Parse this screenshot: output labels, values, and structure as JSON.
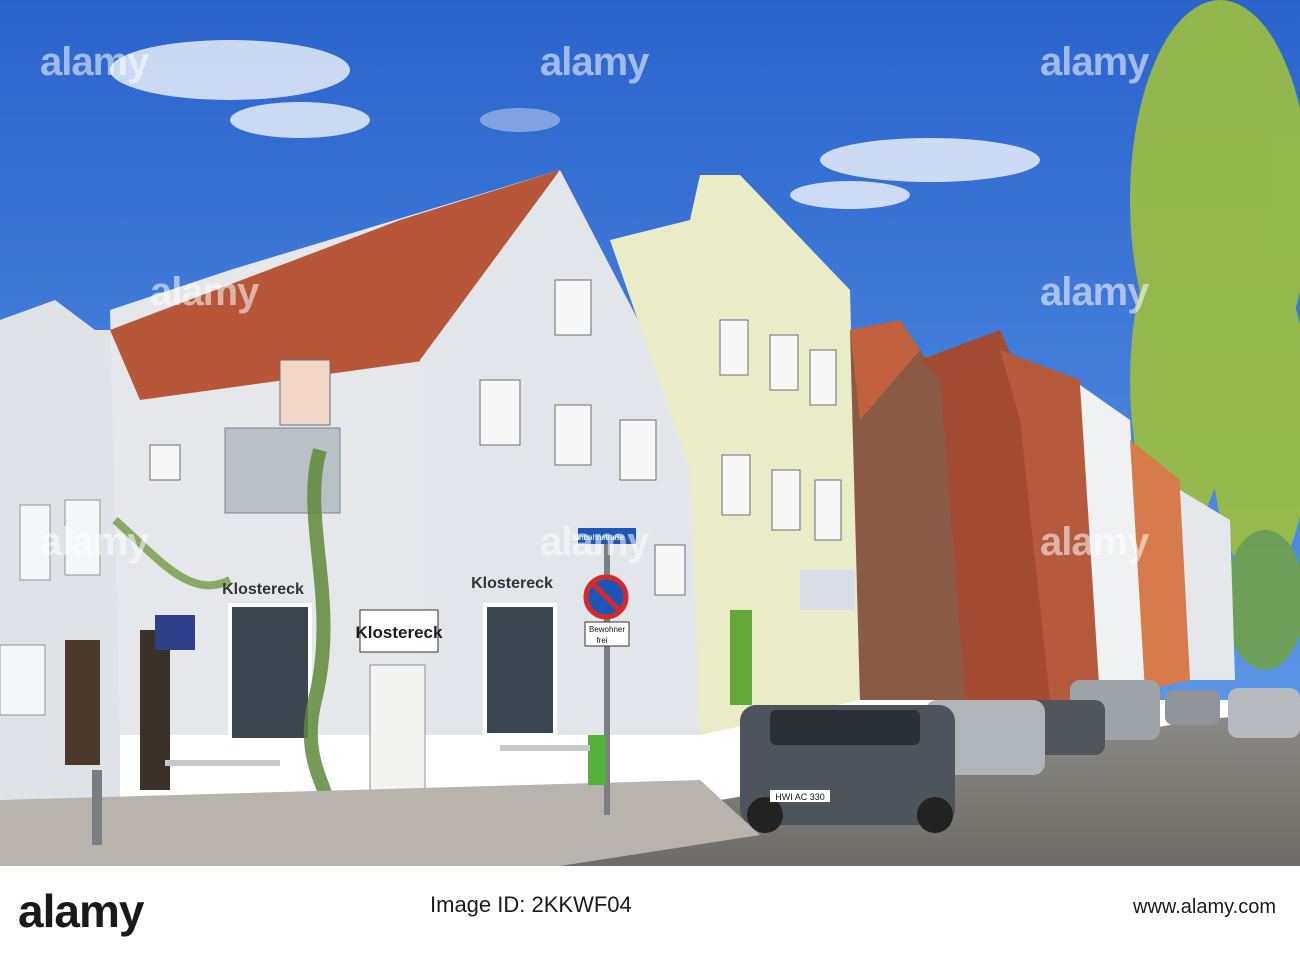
{
  "watermark": {
    "brand": "alamy",
    "image_id": "Image ID: 2KKWF04",
    "site": "www.alamy.com"
  },
  "signs": {
    "restaurant_name_large": "Klostereck",
    "restaurant_name_gable": "Klostereck",
    "restaurant_name_left": "Klostereck",
    "oneway": "Einbahnstraße",
    "resident_sign_line1": "Bewohner",
    "resident_sign_line2": "frei",
    "car_plate_front": "HWI AC 330"
  },
  "colors": {
    "sky": "#2f6fd6",
    "roof": "#b8563a",
    "white_house": "#e7e9ec",
    "yellow_house": "#e9ecc6",
    "brick": "#8a5a45"
  }
}
